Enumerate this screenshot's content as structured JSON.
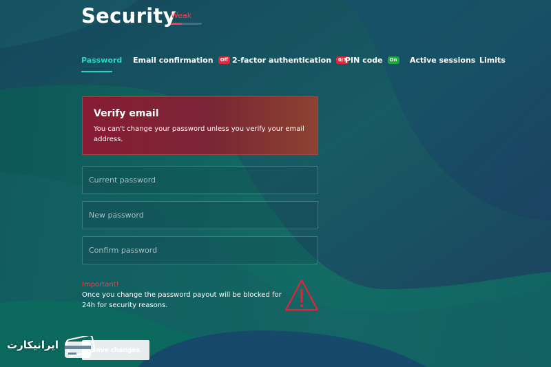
{
  "colors": {
    "accent": "#27d6c6",
    "danger": "#ff3b4a",
    "badge_on": "#1fa63c",
    "badge_off": "#e3263b"
  },
  "header": {
    "title": "Security",
    "strength_label": "Weak",
    "strength_level": 0.35
  },
  "tabs": [
    {
      "label": "Password",
      "active": true
    },
    {
      "label": "Email confirmation",
      "badge": "Off",
      "badge_color": "red"
    },
    {
      "label": "2-factor authentication",
      "badge": "0/3",
      "badge_color": "red"
    },
    {
      "label": "PIN code",
      "badge": "On",
      "badge_color": "green"
    },
    {
      "label": "Active sessions"
    },
    {
      "label": "Limits"
    }
  ],
  "alert": {
    "title": "Verify email",
    "text": "You can't change your password unless you verify your email address."
  },
  "form": {
    "current_password_placeholder": "Current password",
    "new_password_placeholder": "New password",
    "confirm_password_placeholder": "Confirm password"
  },
  "notice": {
    "title": "Important!",
    "text": "Once you change the password payout will be blocked for 24h for security reasons.",
    "icon": "warning-icon"
  },
  "save_button_label": "Save changes",
  "watermark": {
    "text": "ایرانیکارت",
    "icon": "credit-card-logo-icon"
  }
}
